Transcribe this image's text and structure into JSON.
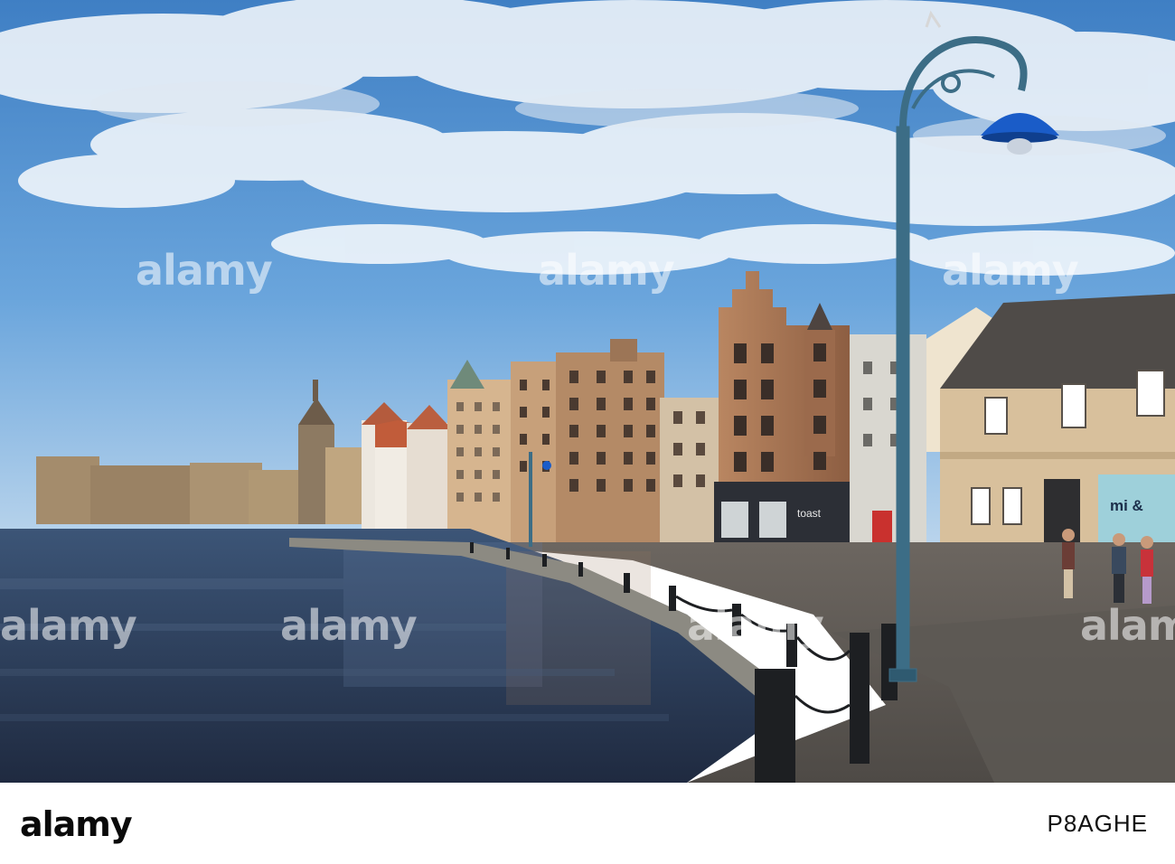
{
  "photo": {
    "sky_top": "#4a84c4",
    "sky_bottom": "#9cc6ea",
    "water": "#2f3f5e",
    "shopfront_sign": "toast",
    "partial_shop_sign": "mi &"
  },
  "watermark": {
    "text": "alamy"
  },
  "footer": {
    "brand": "alamy",
    "image_id": "P8AGHE"
  }
}
